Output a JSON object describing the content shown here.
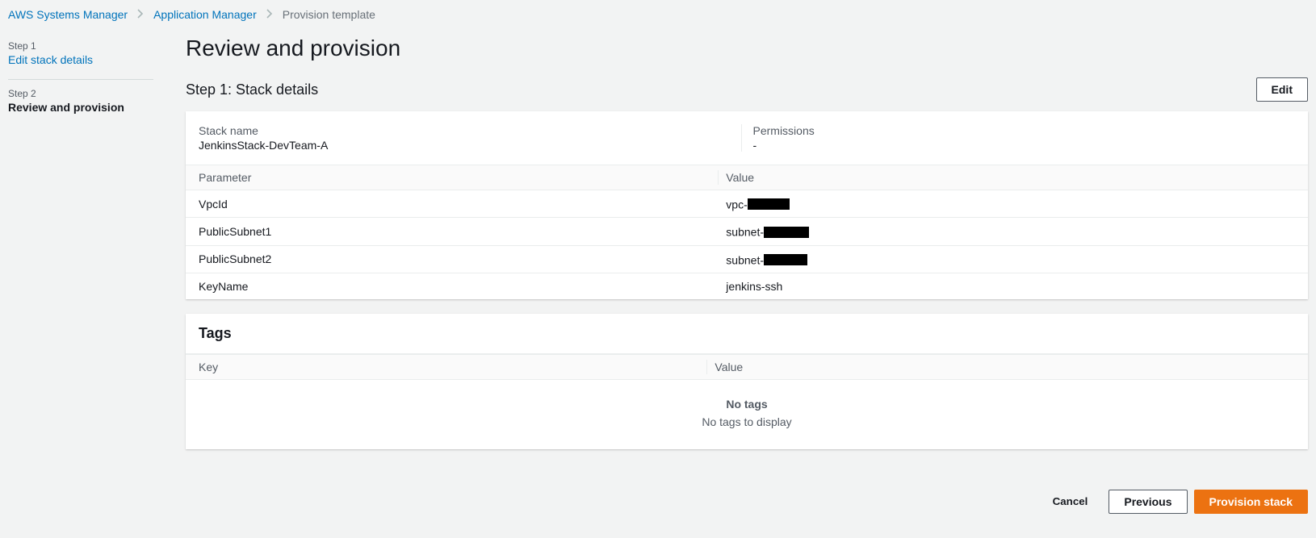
{
  "breadcrumb": {
    "item1": "AWS Systems Manager",
    "item2": "Application Manager",
    "item3": "Provision template"
  },
  "sidebar": {
    "step1_label": "Step 1",
    "step1_title": "Edit stack details",
    "step2_label": "Step 2",
    "step2_title": "Review and provision"
  },
  "page": {
    "title": "Review and provision",
    "section1_title": "Step 1: Stack details",
    "edit_button": "Edit"
  },
  "details": {
    "stack_name_label": "Stack name",
    "stack_name_value": "JenkinsStack-DevTeam-A",
    "permissions_label": "Permissions",
    "permissions_value": "-"
  },
  "parameters": {
    "col_parameter": "Parameter",
    "col_value": "Value",
    "rows": [
      {
        "param": "VpcId",
        "prefix": "vpc-",
        "redacted": true,
        "width": "w1"
      },
      {
        "param": "PublicSubnet1",
        "prefix": "subnet-",
        "redacted": true,
        "width": "w2"
      },
      {
        "param": "PublicSubnet2",
        "prefix": "subnet-",
        "redacted": true,
        "width": "w3"
      },
      {
        "param": "KeyName",
        "prefix": "",
        "redacted": false,
        "value": "jenkins-ssh"
      }
    ]
  },
  "tags": {
    "header": "Tags",
    "col_key": "Key",
    "col_value": "Value",
    "empty_title": "No tags",
    "empty_subtitle": "No tags to display"
  },
  "footer": {
    "cancel": "Cancel",
    "previous": "Previous",
    "provision": "Provision stack"
  }
}
